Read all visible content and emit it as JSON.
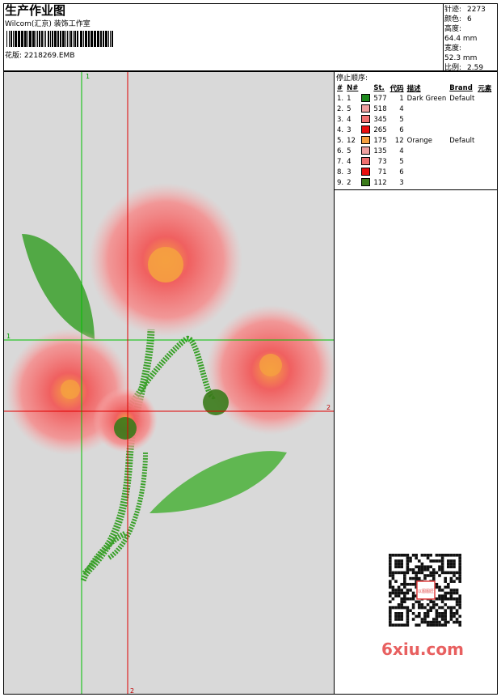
{
  "header": {
    "title": "生产作业图",
    "studio": "Wilcom(汇京) 装饰工作室",
    "design_label": "花版:",
    "design_file": "2218269.EMB"
  },
  "stats": {
    "stitches_label": "针迹:",
    "stitches": "2273",
    "colors_label": "颜色:",
    "colors": "6",
    "height_label": "高度:",
    "height": "64.4 mm",
    "width_label": "宽度:",
    "width": "52.3 mm",
    "ratio_label": "比例:",
    "ratio": "2.59"
  },
  "sequence": {
    "title": "停止顺序:",
    "columns": [
      "#",
      "N#",
      "St.",
      "代码",
      "描述",
      "Brand",
      "元素"
    ],
    "rows": [
      {
        "idx": "1.",
        "n": "1",
        "st": "577",
        "code": "1",
        "desc": "Dark Green",
        "brand": "Default",
        "color": "#1e8a1e"
      },
      {
        "idx": "2.",
        "n": "5",
        "st": "518",
        "code": "4",
        "desc": "",
        "brand": "",
        "color": "#f0a0a0"
      },
      {
        "idx": "3.",
        "n": "4",
        "st": "345",
        "code": "5",
        "desc": "",
        "brand": "",
        "color": "#f07070"
      },
      {
        "idx": "4.",
        "n": "3",
        "st": "265",
        "code": "6",
        "desc": "",
        "brand": "",
        "color": "#e81010"
      },
      {
        "idx": "5.",
        "n": "12",
        "st": "175",
        "code": "12",
        "desc": "Orange",
        "brand": "Default",
        "color": "#f5a040"
      },
      {
        "idx": "6.",
        "n": "5",
        "st": "135",
        "code": "4",
        "desc": "",
        "brand": "",
        "color": "#f0a0a0"
      },
      {
        "idx": "7.",
        "n": "4",
        "st": "73",
        "code": "5",
        "desc": "",
        "brand": "",
        "color": "#f07070"
      },
      {
        "idx": "8.",
        "n": "3",
        "st": "71",
        "code": "6",
        "desc": "",
        "brand": "",
        "color": "#e81010"
      },
      {
        "idx": "9.",
        "n": "2",
        "st": "112",
        "code": "3",
        "desc": "",
        "brand": "",
        "color": "#3a7a1a"
      }
    ]
  },
  "canvas": {
    "guide_green_v_label": "1",
    "guide_green_h_label": "1",
    "guide_red_h_label": "2",
    "guide_red_v_label": "2",
    "guide_green": "#00c000",
    "guide_red": "#e00000"
  },
  "watermark": {
    "text": "6xiu.com",
    "qr_badge": "以图图匠"
  }
}
